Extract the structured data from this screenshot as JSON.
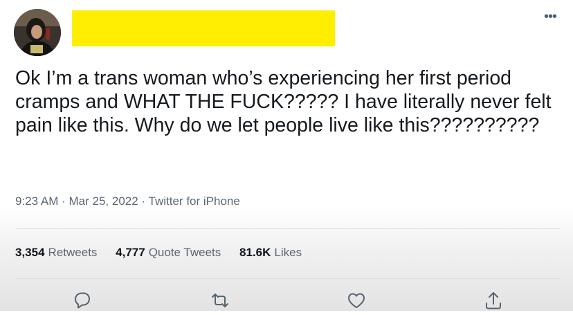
{
  "tweet": {
    "text": "Ok I’m a trans woman who’s experiencing her first period cramps and WHAT THE FUCK????? I have literally never felt pain like this. Why do we let people live like this??????????",
    "time": "9:23 AM",
    "date": "Mar 25, 2022",
    "source": "Twitter for iPhone",
    "separator": "·"
  },
  "stats": {
    "retweets_count": "3,354",
    "retweets_label": "Retweets",
    "quotes_count": "4,777",
    "quotes_label": "Quote Tweets",
    "likes_count": "81.6K",
    "likes_label": "Likes"
  },
  "icons": {
    "more": "more-icon",
    "reply": "reply-icon",
    "retweet": "retweet-icon",
    "like": "like-icon",
    "share": "share-icon"
  },
  "colors": {
    "redaction": "#ffee00",
    "text": "#0f1419",
    "secondary": "#536471"
  }
}
